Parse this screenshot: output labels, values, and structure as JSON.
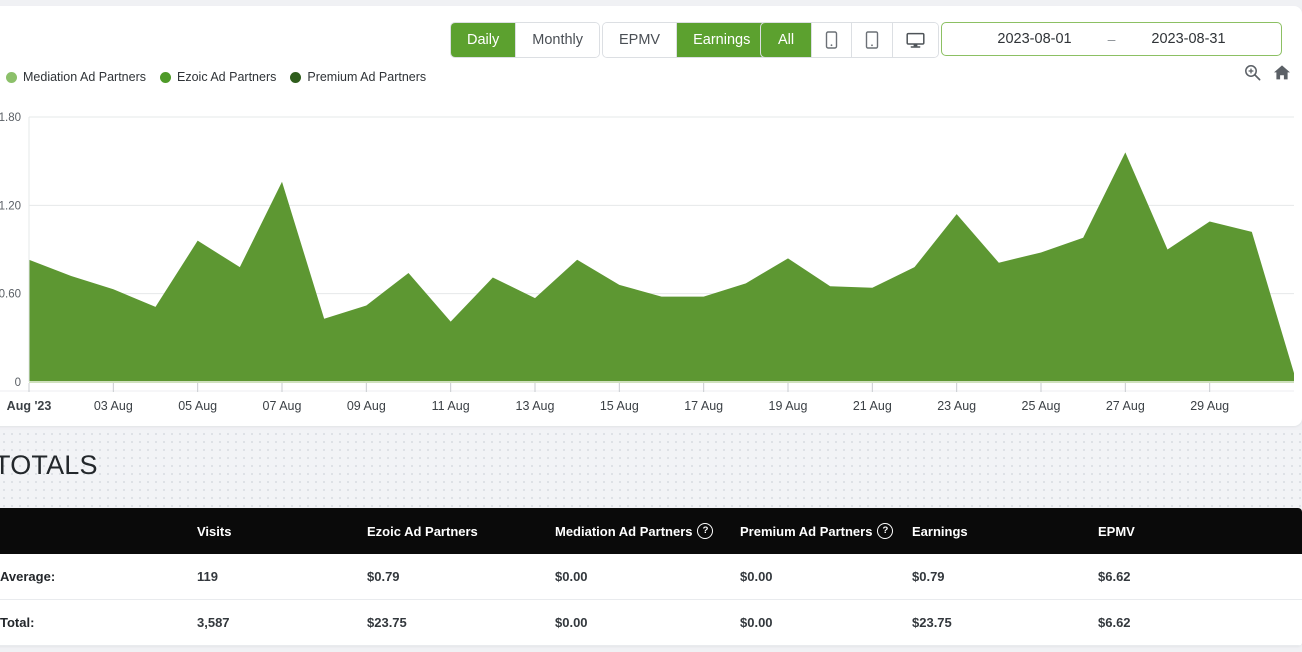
{
  "toolbar": {
    "interval_group": [
      {
        "label": "Daily",
        "active": true
      },
      {
        "label": "Monthly",
        "active": false
      }
    ],
    "metric_group": [
      {
        "label": "EPMV",
        "active": false
      },
      {
        "label": "Earnings",
        "active": true
      }
    ],
    "device_group": [
      {
        "label": "All",
        "icon": "",
        "active": true
      },
      {
        "label": "",
        "icon": "mobile-icon",
        "active": false
      },
      {
        "label": "",
        "icon": "tablet-icon",
        "active": false
      },
      {
        "label": "",
        "icon": "desktop-icon",
        "active": false
      }
    ],
    "date_range": {
      "start": "2023-08-01",
      "separator": "–",
      "end": "2023-08-31"
    }
  },
  "icons": {
    "zoom_in": "zoom-in-icon",
    "home": "home-icon"
  },
  "legend": [
    {
      "label": "Mediation Ad Partners",
      "color": "#8cc06a"
    },
    {
      "label": "Ezoic Ad Partners",
      "color": "#4e9a28"
    },
    {
      "label": "Premium Ad Partners",
      "color": "#2f5d1c"
    }
  ],
  "totals_heading": "TOTALS",
  "table": {
    "columns": [
      {
        "label": "",
        "help": false
      },
      {
        "label": "Visits",
        "help": false
      },
      {
        "label": "Ezoic Ad Partners",
        "help": false
      },
      {
        "label": "Mediation Ad Partners",
        "help": true
      },
      {
        "label": "Premium Ad Partners",
        "help": true
      },
      {
        "label": "Earnings",
        "help": false
      },
      {
        "label": "EPMV",
        "help": false
      }
    ],
    "help_glyph": "?",
    "rows": [
      {
        "label": "Average:",
        "visits": "119",
        "ezoic": "$0.79",
        "mediation": "$0.00",
        "premium": "$0.00",
        "earnings": "$0.79",
        "epmv": "$6.62"
      },
      {
        "label": "Total:",
        "visits": "3,587",
        "ezoic": "$23.75",
        "mediation": "$0.00",
        "premium": "$0.00",
        "earnings": "$23.75",
        "epmv": "$6.62"
      }
    ]
  },
  "chart_data": {
    "type": "area",
    "title": "",
    "xlabel": "",
    "ylabel": "",
    "ylim": [
      0,
      1.8
    ],
    "yticks": [
      0,
      0.6,
      1.2,
      1.8
    ],
    "ytick_labels": [
      "0",
      "0.60",
      "1.20",
      "1.80"
    ],
    "grid": true,
    "legend_position": "top-left",
    "fill_color": "#5d9732",
    "xtick_labels": [
      "Aug '23",
      "03 Aug",
      "05 Aug",
      "07 Aug",
      "09 Aug",
      "11 Aug",
      "13 Aug",
      "15 Aug",
      "17 Aug",
      "19 Aug",
      "21 Aug",
      "23 Aug",
      "25 Aug",
      "27 Aug",
      "29 Aug"
    ],
    "x": [
      "2023-08-01",
      "2023-08-02",
      "2023-08-03",
      "2023-08-04",
      "2023-08-05",
      "2023-08-06",
      "2023-08-07",
      "2023-08-08",
      "2023-08-09",
      "2023-08-10",
      "2023-08-11",
      "2023-08-12",
      "2023-08-13",
      "2023-08-14",
      "2023-08-15",
      "2023-08-16",
      "2023-08-17",
      "2023-08-18",
      "2023-08-19",
      "2023-08-20",
      "2023-08-21",
      "2023-08-22",
      "2023-08-23",
      "2023-08-24",
      "2023-08-25",
      "2023-08-26",
      "2023-08-27",
      "2023-08-28",
      "2023-08-29",
      "2023-08-30",
      "2023-08-31"
    ],
    "series": [
      {
        "name": "Earnings",
        "values": [
          0.83,
          0.72,
          0.63,
          0.51,
          0.96,
          0.78,
          1.36,
          0.43,
          0.52,
          0.74,
          0.41,
          0.71,
          0.57,
          0.83,
          0.66,
          0.58,
          0.58,
          0.67,
          0.84,
          0.65,
          0.64,
          0.78,
          1.14,
          0.81,
          0.88,
          0.98,
          1.56,
          0.9,
          1.09,
          1.02,
          0.06
        ]
      }
    ]
  }
}
